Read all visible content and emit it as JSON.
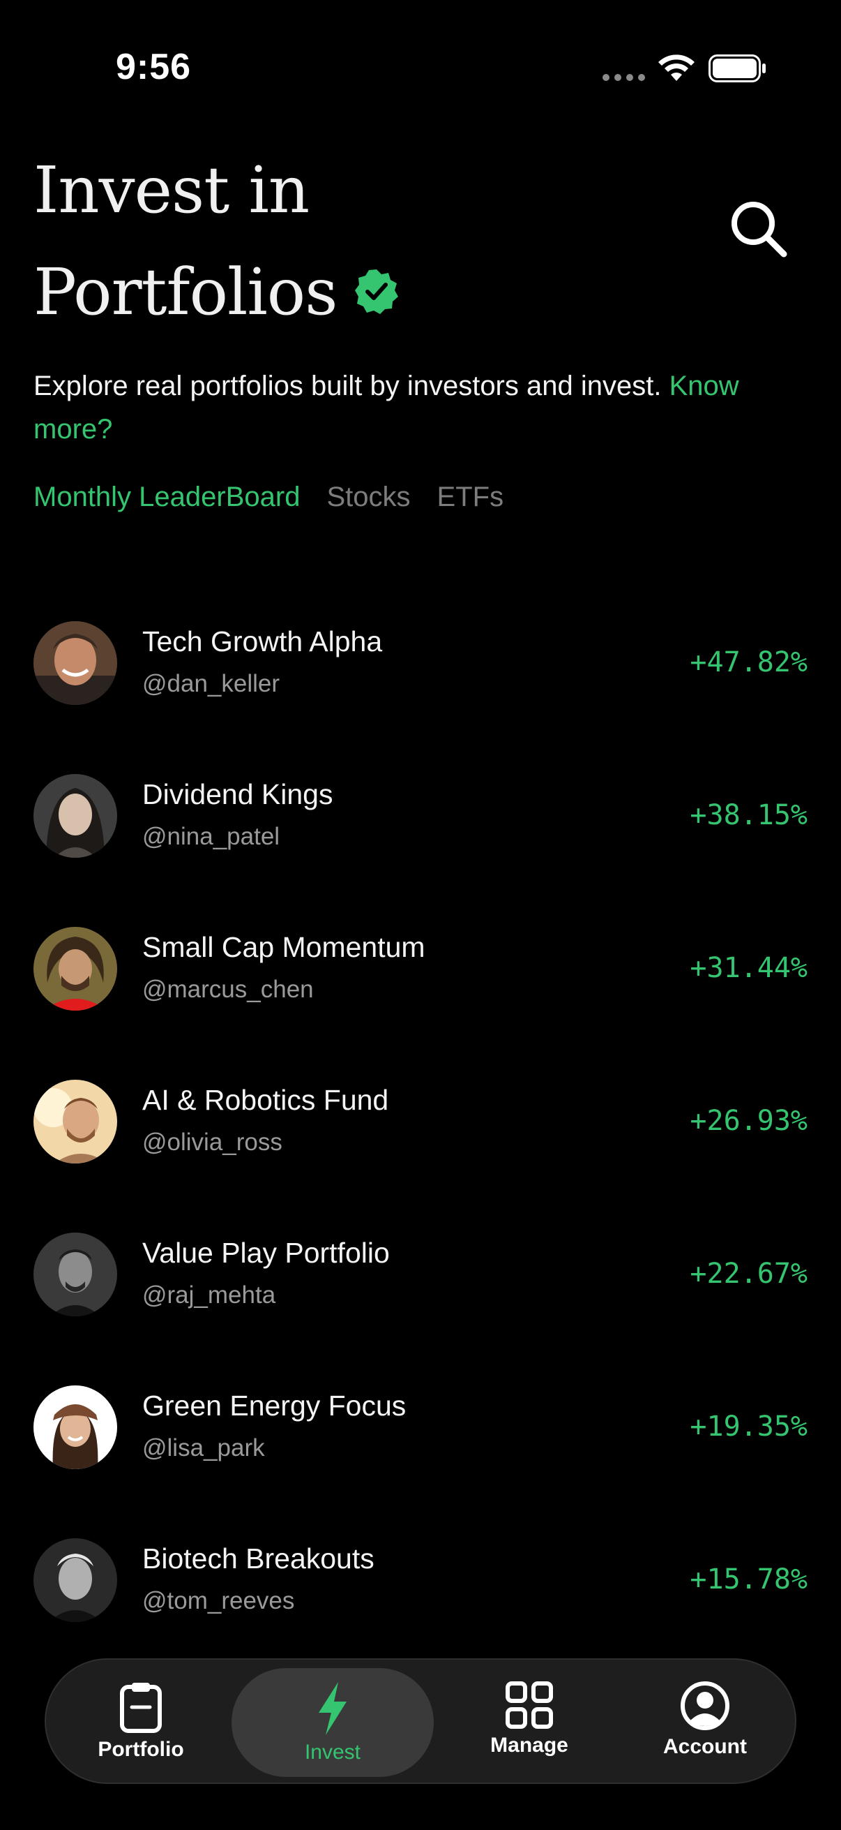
{
  "status_bar": {
    "time": "9:56"
  },
  "header": {
    "title_line1": "Invest in",
    "title_line2": "Portfolios",
    "description": "Explore real portfolios built by investors and invest. ",
    "know_more": "Know more?"
  },
  "tabs": [
    {
      "label": "Monthly LeaderBoard",
      "active": true
    },
    {
      "label": "Stocks",
      "active": false
    },
    {
      "label": "ETFs",
      "active": false
    }
  ],
  "portfolios": [
    {
      "name": "Tech Growth Alpha",
      "handle": "@dan_keller",
      "return": "+47.82%"
    },
    {
      "name": "Dividend Kings",
      "handle": "@nina_patel",
      "return": "+38.15%"
    },
    {
      "name": "Small Cap Momentum",
      "handle": "@marcus_chen",
      "return": "+31.44%"
    },
    {
      "name": "AI & Robotics Fund",
      "handle": "@olivia_ross",
      "return": "+26.93%"
    },
    {
      "name": "Value Play Portfolio",
      "handle": "@raj_mehta",
      "return": "+22.67%"
    },
    {
      "name": "Green Energy Focus",
      "handle": "@lisa_park",
      "return": "+19.35%"
    },
    {
      "name": "Biotech Breakouts",
      "handle": "@tom_reeves",
      "return": "+15.78%"
    }
  ],
  "nav": [
    {
      "label": "Portfolio",
      "icon": "clipboard-icon",
      "active": false
    },
    {
      "label": "Invest",
      "icon": "lightning-icon",
      "active": true
    },
    {
      "label": "Manage",
      "icon": "grid-icon",
      "active": false
    },
    {
      "label": "Account",
      "icon": "user-circle-icon",
      "active": false
    }
  ],
  "colors": {
    "accent": "#35c46f",
    "background": "#000000",
    "muted": "#7d7d7d"
  }
}
